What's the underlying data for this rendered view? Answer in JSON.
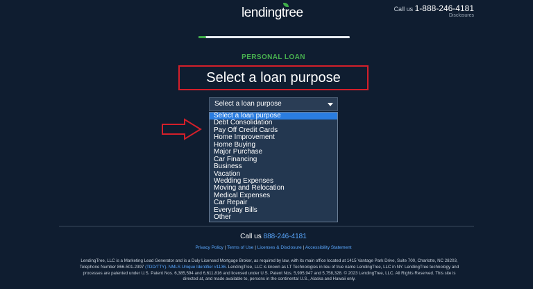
{
  "header": {
    "logo_text": "lendingtree",
    "call_label": "Call us",
    "phone": "1-888-246-4181",
    "disclosures": "Disclosures"
  },
  "progress": {
    "fraction": 0.05
  },
  "form": {
    "eyebrow": "PERSONAL LOAN",
    "title": "Select a loan purpose",
    "select_value": "Select a loan purpose",
    "options": [
      "Select a loan purpose",
      "Debt Consolidation",
      "Pay Off Credit Cards",
      "Home Improvement",
      "Home Buying",
      "Major Purchase",
      "Car Financing",
      "Business",
      "Vacation",
      "Wedding Expenses",
      "Moving and Relocation",
      "Medical Expenses",
      "Car Repair",
      "Everyday Bills",
      "Other"
    ]
  },
  "footer": {
    "call_label": "Call us",
    "phone": "888-246-4181",
    "links": [
      "Privacy Policy",
      "Terms of Use",
      "Licenses & Disclosure",
      "Accessibility Statement"
    ],
    "legal_1": "LendingTree, LLC is a Marketing Lead Generator and is a Duly Licensed Mortgage Broker, as required by law, with its main office located at 1415 Vantage Park Drive, Suite 700, Charlotte, NC 28203, Telephone Number 866-501-2397 ",
    "legal_link_1": "(TDD/TTY)",
    "legal_2": ". ",
    "legal_link_2": "NMLS Unique Identifier #1136",
    "legal_3": ". LendingTree, LLC is known as LT Technologies in lieu of true name LendingTree, LLC in NY. LendingTree technology and processes are patented under U.S. Patent Nos. 6,385,594 and 6,611,816 and licensed under U.S. Patent Nos. 5,995,947 and 5,758,328. © 2023 LendingTree, LLC. All Rights Reserved. This site is directed at, and made available to, persons in the continental U.S., Alaska and Hawaii only."
  },
  "colors": {
    "background": "#0f1d30",
    "accent_green": "#3fae49",
    "highlight_red": "#d41f2a",
    "link_blue": "#5aa8ff",
    "option_selected": "#2a7de1"
  }
}
